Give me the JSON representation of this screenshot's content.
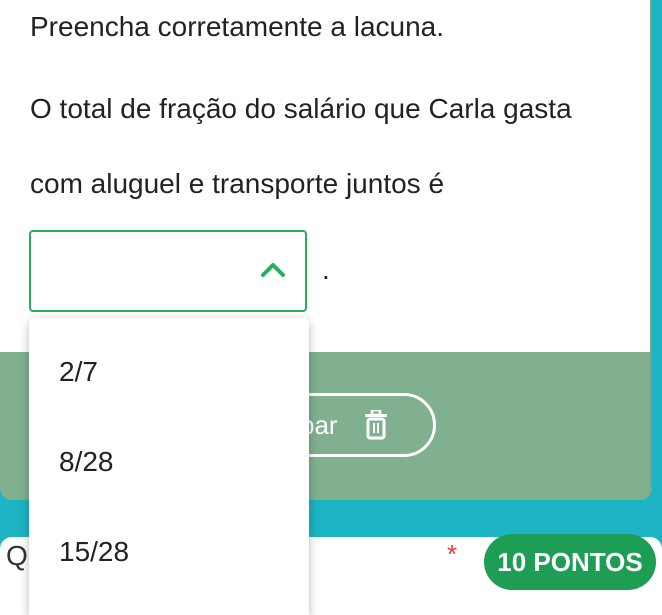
{
  "question": {
    "instruction": "Preencha corretamente a lacuna.",
    "line1": "O total de fração do salário que Carla gasta",
    "line2": "com aluguel e transporte juntos é",
    "trailing": "."
  },
  "dropdown": {
    "selected": "",
    "options": [
      "2/7",
      "8/28",
      "15/28"
    ],
    "expanded": true
  },
  "clear_button": {
    "label_visible": "par"
  },
  "next_question": {
    "letter": "Q",
    "required_mark": "*",
    "points_label": "10 PONTOS"
  },
  "colors": {
    "page_bg": "#1db5c4",
    "card_bottom": "#80b090",
    "accent_green": "#27ae60",
    "points_green": "#1e9e55",
    "required_red": "#e53935"
  }
}
